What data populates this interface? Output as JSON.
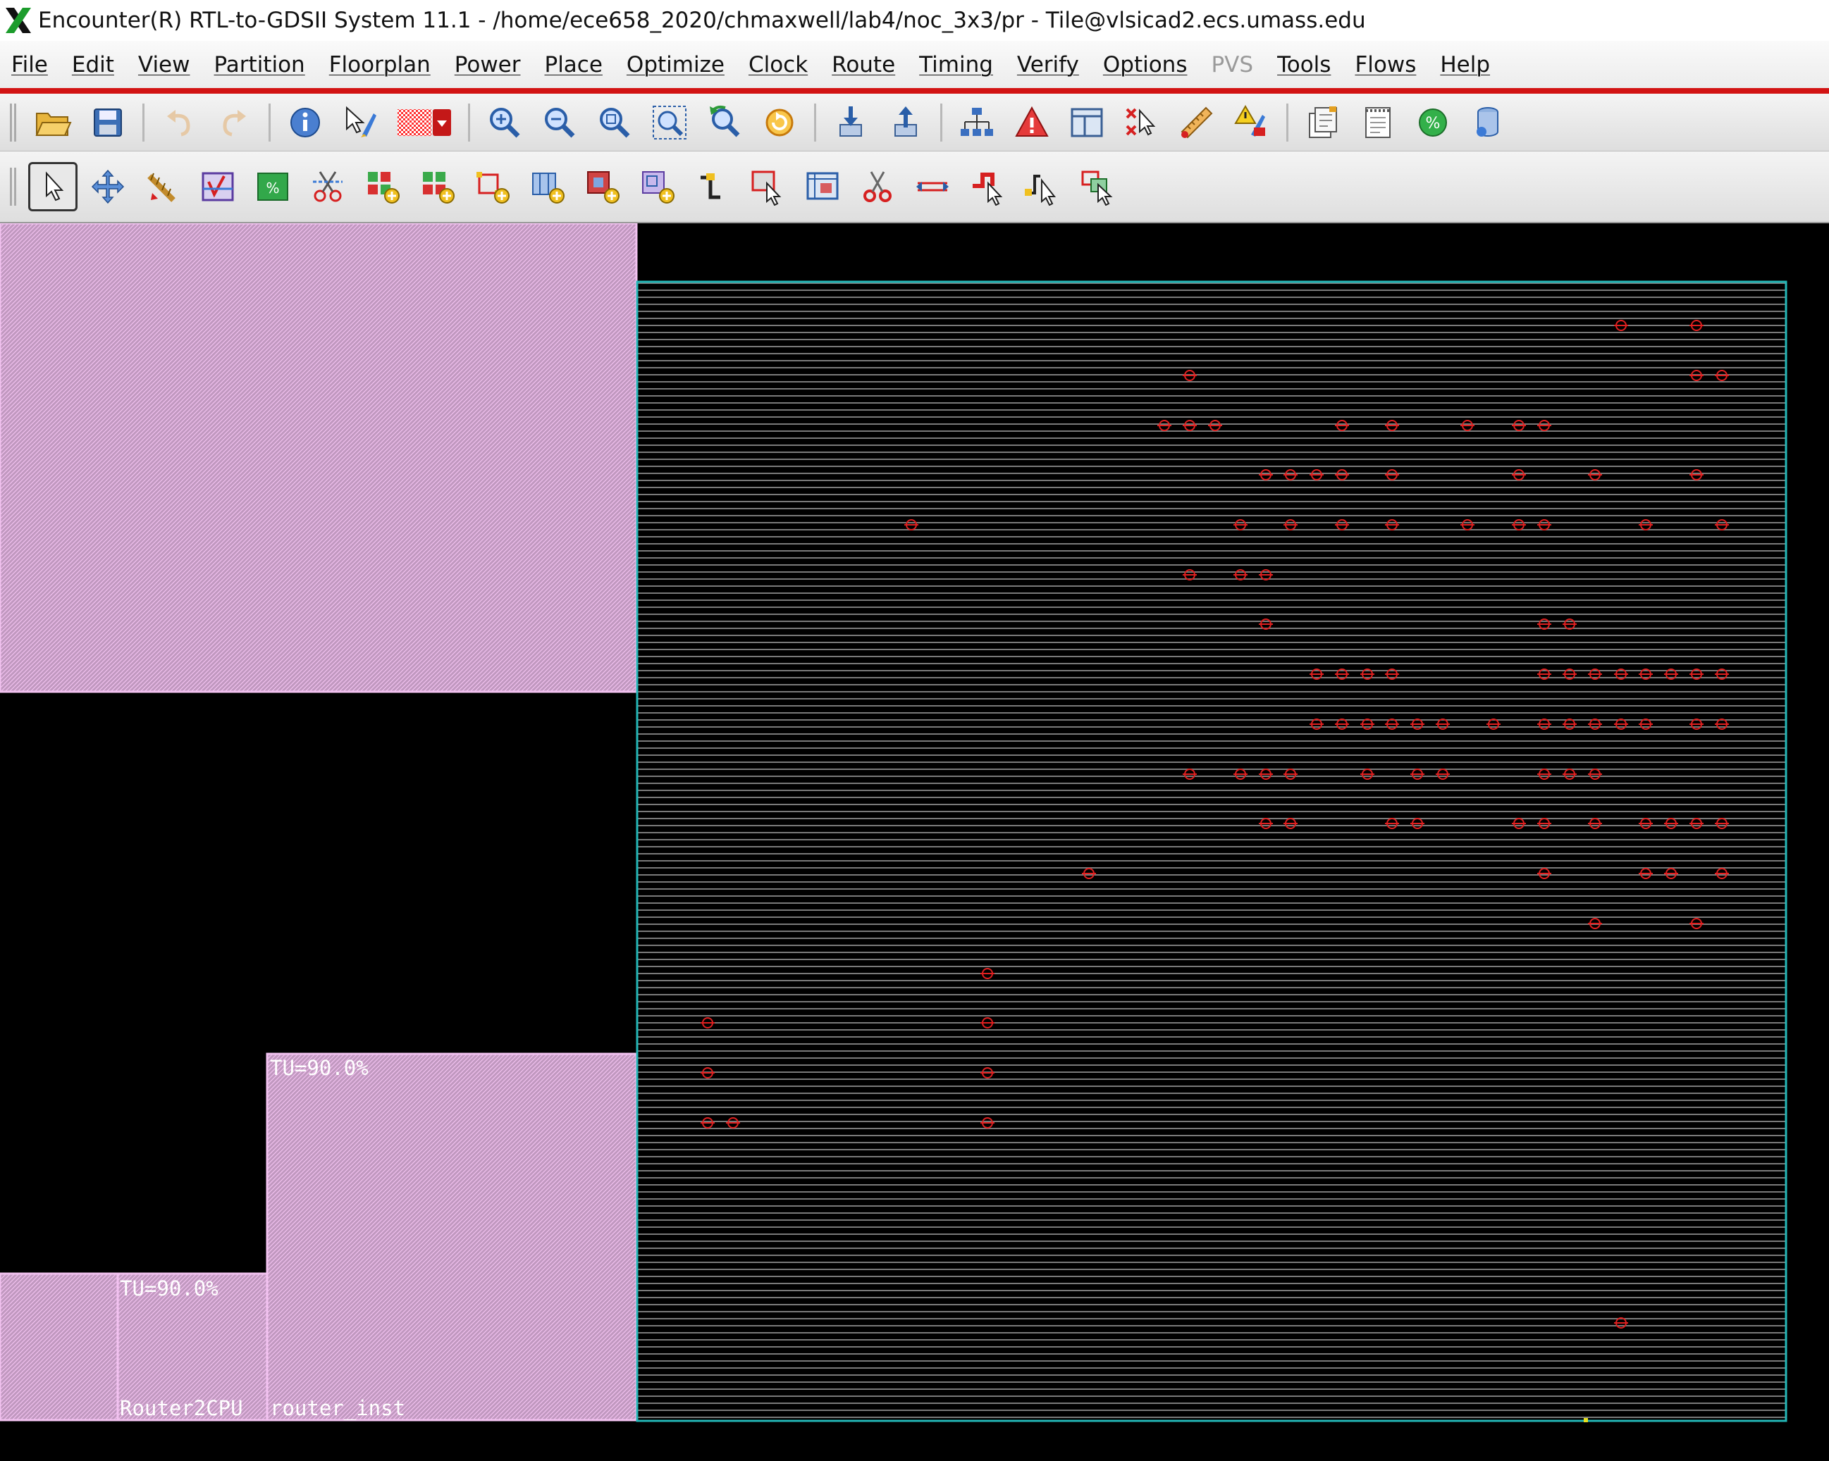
{
  "window": {
    "title": "Encounter(R) RTL-to-GDSII System 11.1 - /home/ece658_2020/chmaxwell/lab4/noc_3x3/pr - Tile@vlsicad2.ecs.umass.edu"
  },
  "menu": {
    "file": "File",
    "edit": "Edit",
    "view": "View",
    "partition": "Partition",
    "floorplan": "Floorplan",
    "power": "Power",
    "place": "Place",
    "optimize": "Optimize",
    "clock": "Clock",
    "route": "Route",
    "timing": "Timing",
    "verify": "Verify",
    "options": "Options",
    "pvs": "PVS",
    "tools": "Tools",
    "flows": "Flows",
    "help": "Help"
  },
  "toolbar1": {
    "icons": [
      "open-folder-icon",
      "save-icon",
      "undo-icon",
      "redo-icon",
      "info-icon",
      "design-browser-icon",
      "color-pattern-icon",
      "zoom-in-icon",
      "zoom-out-icon",
      "zoom-select-icon",
      "zoom-fit-icon",
      "zoom-previous-icon",
      "redraw-icon",
      "push-down-icon",
      "pop-up-icon",
      "hierarchy-icon",
      "violation-icon",
      "layout-panel-icon",
      "deselect-icon",
      "ruler-icon",
      "warning-icon",
      "notes-icon",
      "log-icon",
      "percentage-icon",
      "database-icon"
    ]
  },
  "toolbar2": {
    "icons": [
      "select-arrow-icon",
      "move-icon",
      "stretch-icon",
      "placement-check-icon",
      "density-icon",
      "cut-wire-icon",
      "add-cell-icon",
      "add-cell2-icon",
      "add-pin-icon",
      "add-partition-icon",
      "add-block-icon",
      "add-region-icon",
      "add-wire-icon",
      "select-area-icon",
      "add-blockage-icon",
      "scissors-icon",
      "spacing-icon",
      "edit-shape-icon",
      "select-pin-icon",
      "select-multi-icon"
    ]
  },
  "layout": {
    "colors": {
      "partition_fill": "#c098bf",
      "partition_border": "#f2c2f0",
      "core_border": "#23b7b7",
      "row_line": "#7a7a7a",
      "marker": "#e02020",
      "canvas_bg": "#000000"
    },
    "blocks": [
      {
        "label": "TU=90.0%"
      },
      {
        "label": "TU=90.0%"
      },
      {
        "label": "Router2CPU"
      },
      {
        "label": "router_inst"
      }
    ]
  }
}
